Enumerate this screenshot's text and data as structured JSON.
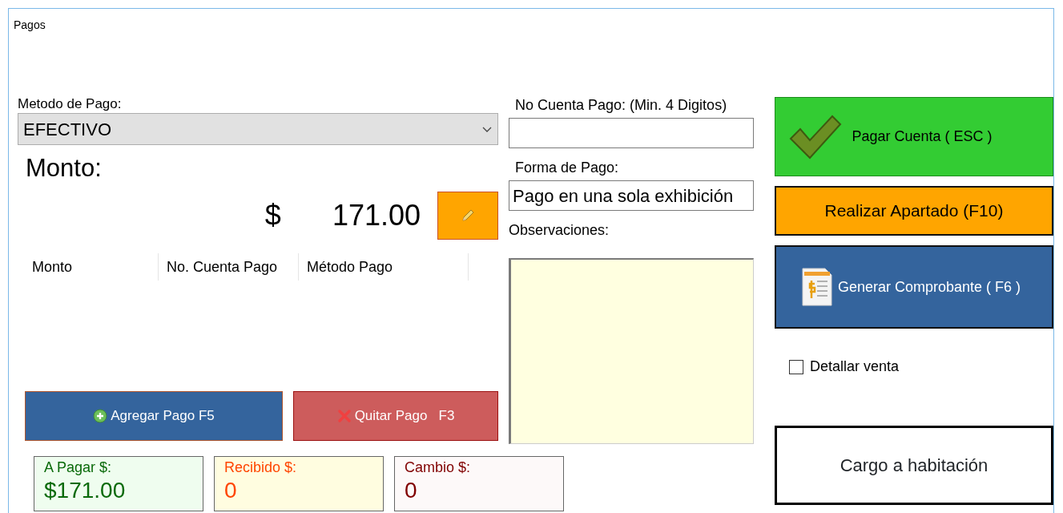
{
  "window": {
    "title": "Pagos"
  },
  "payment_method": {
    "label": "Metodo de Pago:",
    "value": "EFECTIVO"
  },
  "amount": {
    "label": "Monto:",
    "currency": "$",
    "value": "171.00"
  },
  "payments_table": {
    "columns": [
      "Monto",
      "No. Cuenta Pago",
      "Método Pago"
    ]
  },
  "payment_buttons": [
    {
      "label": "Agregar Pago F5",
      "kind": "add"
    },
    {
      "label": "Quitar Pago   F3",
      "kind": "remove"
    }
  ],
  "totals": [
    {
      "label": "A Pagar $:",
      "value": "$171.00",
      "kind": "due"
    },
    {
      "label": "Recibido $:",
      "value": "0",
      "kind": "received"
    },
    {
      "label": "Cambio $:",
      "value": "0",
      "kind": "change"
    }
  ],
  "account": {
    "label": "No Cuenta Pago: (Min. 4 Digitos)"
  },
  "payment_form": {
    "label": "Forma de Pago:",
    "value": "Pago en una sola exhibición"
  },
  "notes": {
    "label": "Observaciones:"
  },
  "actions": [
    {
      "label": "Pagar Cuenta ( ESC )",
      "kind": "pay"
    },
    {
      "label": "Realizar Apartado (F10)",
      "kind": "layaway"
    },
    {
      "label": "Generar Comprobante ( F6 )",
      "kind": "receipt"
    }
  ],
  "detail_sale": {
    "label": "Detallar venta",
    "checked": false
  },
  "room_charge": {
    "label": "Cargo a habitación"
  }
}
